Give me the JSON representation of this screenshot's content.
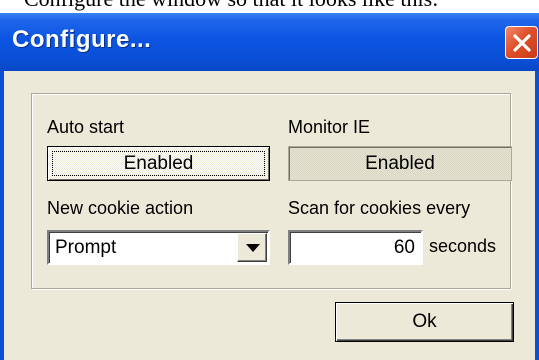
{
  "caption_fragment": "Configure the window so that it looks like this:",
  "window": {
    "title": "Configure...",
    "close_icon": "close-x-icon",
    "accent_color": "#0a4fd6",
    "close_color": "#e0502a"
  },
  "settings": {
    "auto_start_label": "Auto start",
    "auto_start_value": "Enabled",
    "monitor_ie_label": "Monitor IE",
    "monitor_ie_value": "Enabled",
    "cookie_action_label": "New cookie action",
    "cookie_action_value": "Prompt",
    "scan_label": "Scan for cookies every",
    "scan_value": "60",
    "scan_unit": "seconds"
  },
  "buttons": {
    "ok_label": "Ok"
  }
}
